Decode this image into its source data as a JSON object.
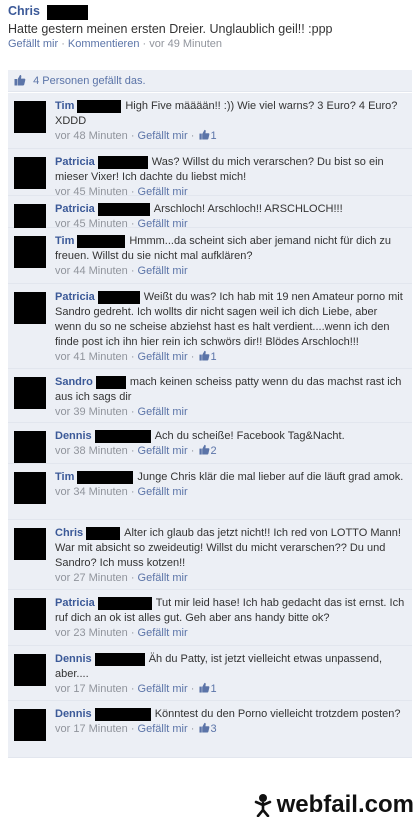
{
  "post": {
    "author": "Chris",
    "text": "Hatte gestern meinen ersten Dreier. Unglaublich geil!! :ppp",
    "like": "Gefällt mir",
    "sep1": "·",
    "comment": "Kommentieren",
    "sep2": "·",
    "time": "vor 49 Minuten"
  },
  "likes": {
    "text": "4 Personen gefällt das."
  },
  "comments": [
    {
      "name": "Tim",
      "text": "High Five määään!! :)) Wie viel warns? 3 Euro? 4 Euro? XDDD",
      "time": "vor 48 Minuten",
      "like": "Gefällt mir",
      "count": "1"
    },
    {
      "name": "Patricia",
      "text": "Was? Willst du mich verarschen? Du bist so ein mieser Vixer! Ich dachte du liebst mich!",
      "time": "vor 45 Minuten",
      "like": "Gefällt mir",
      "count": ""
    },
    {
      "name": "Patricia",
      "text": "Arschloch! Arschloch!! ARSCHLOCH!!!",
      "time": "vor 45 Minuten",
      "like": "Gefällt mir",
      "count": ""
    },
    {
      "name": "Tim",
      "text": "Hmmm...da scheint sich aber jemand nicht für dich zu freuen. Willst du sie nicht mal aufklären?",
      "time": "vor 44 Minuten",
      "like": "Gefällt mir",
      "count": ""
    },
    {
      "name": "Patricia",
      "text": "Weißt du was? Ich hab mit 19 nen Amateur porno mit Sandro gedreht. Ich wollts dir nicht sagen weil ich dich Liebe, aber wenn du so ne scheise abziehst hast es halt verdient....wenn ich den finde post ich ihn hier rein ich schwörs dir!! Blödes Arschloch!!!",
      "time": "vor 41 Minuten",
      "like": "Gefällt mir",
      "count": "1"
    },
    {
      "name": "Sandro",
      "text": "mach keinen scheiss patty wenn du das machst rast ich aus ich sags dir",
      "time": "vor 39 Minuten",
      "like": "Gefällt mir",
      "count": ""
    },
    {
      "name": "Dennis",
      "text": "Ach du scheiße! Facebook Tag&Nacht.",
      "time": "vor 38 Minuten",
      "like": "Gefällt mir",
      "count": "2"
    },
    {
      "name": "Tim",
      "text": "Junge Chris klär die mal lieber auf die läuft grad amok.",
      "time": "vor 34 Minuten",
      "like": "Gefällt mir",
      "count": ""
    },
    {
      "name": "Chris",
      "text": "Alter ich glaub das jetzt nicht!! Ich red von LOTTO Mann! War mit absicht so zweideutig! Willst du micht verarschen?? Du und Sandro? Ich muss kotzen!!",
      "time": "vor 27 Minuten",
      "like": "Gefällt mir",
      "count": ""
    },
    {
      "name": "Patricia",
      "text": "Tut mir leid hase! Ich hab gedacht das ist ernst. Ich ruf dich an ok ist alles gut. Geh aber ans handy bitte ok?",
      "time": "vor 23 Minuten",
      "like": "Gefällt mir",
      "count": ""
    },
    {
      "name": "Dennis",
      "text": "Äh du Patty, ist jetzt vielleicht etwas unpassend, aber....",
      "time": "vor 17 Minuten",
      "like": "Gefällt mir",
      "count": "1"
    },
    {
      "name": "Dennis",
      "text": "Könntest du den Porno vielleicht trotzdem posten?",
      "time": "vor 17 Minuten",
      "like": "Gefällt mir",
      "count": "3"
    }
  ],
  "watermark": {
    "text": "webfail.com"
  }
}
